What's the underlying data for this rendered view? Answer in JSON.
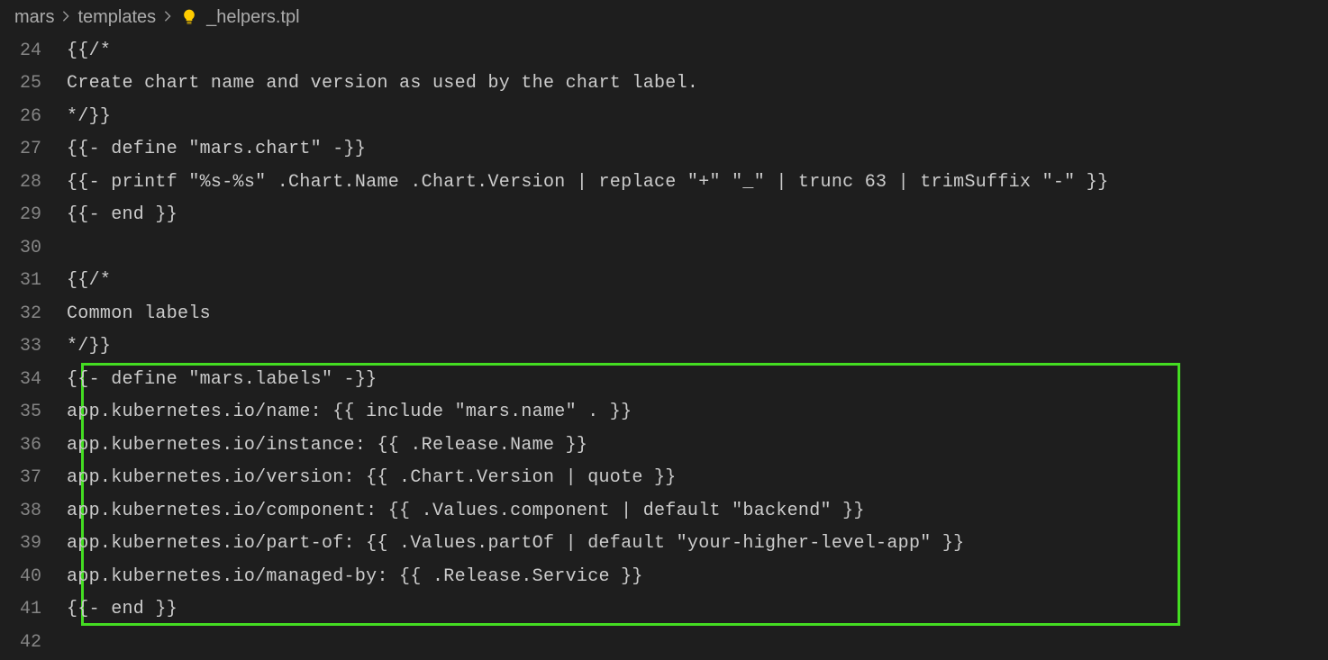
{
  "breadcrumb": {
    "seg1": "mars",
    "seg2": "templates",
    "seg3": "_helpers.tpl"
  },
  "lines": {
    "l24": {
      "num": "24",
      "text": "{{/*"
    },
    "l25": {
      "num": "25",
      "text": "Create chart name and version as used by the chart label."
    },
    "l26": {
      "num": "26",
      "text": "*/}}"
    },
    "l27": {
      "num": "27",
      "text": "{{- define \"mars.chart\" -}}"
    },
    "l28": {
      "num": "28",
      "text": "{{- printf \"%s-%s\" .Chart.Name .Chart.Version | replace \"+\" \"_\" | trunc 63 | trimSuffix \"-\" }}"
    },
    "l29": {
      "num": "29",
      "text": "{{- end }}"
    },
    "l30": {
      "num": "30",
      "text": ""
    },
    "l31": {
      "num": "31",
      "text": "{{/*"
    },
    "l32": {
      "num": "32",
      "text": "Common labels"
    },
    "l33": {
      "num": "33",
      "text": "*/}}"
    },
    "l34": {
      "num": "34",
      "text": "{{- define \"mars.labels\" -}}"
    },
    "l35": {
      "num": "35",
      "text": "app.kubernetes.io/name: {{ include \"mars.name\" . }}"
    },
    "l36": {
      "num": "36",
      "text": "app.kubernetes.io/instance: {{ .Release.Name }}"
    },
    "l37": {
      "num": "37",
      "text": "app.kubernetes.io/version: {{ .Chart.Version | quote }}"
    },
    "l38": {
      "num": "38",
      "text": "app.kubernetes.io/component: {{ .Values.component | default \"backend\" }}"
    },
    "l39": {
      "num": "39",
      "text": "app.kubernetes.io/part-of: {{ .Values.partOf | default \"your-higher-level-app\" }}"
    },
    "l40": {
      "num": "40",
      "text": "app.kubernetes.io/managed-by: {{ .Release.Service }}"
    },
    "l41": {
      "num": "41",
      "text": "{{- end }}"
    },
    "l42": {
      "num": "42",
      "text": ""
    }
  }
}
